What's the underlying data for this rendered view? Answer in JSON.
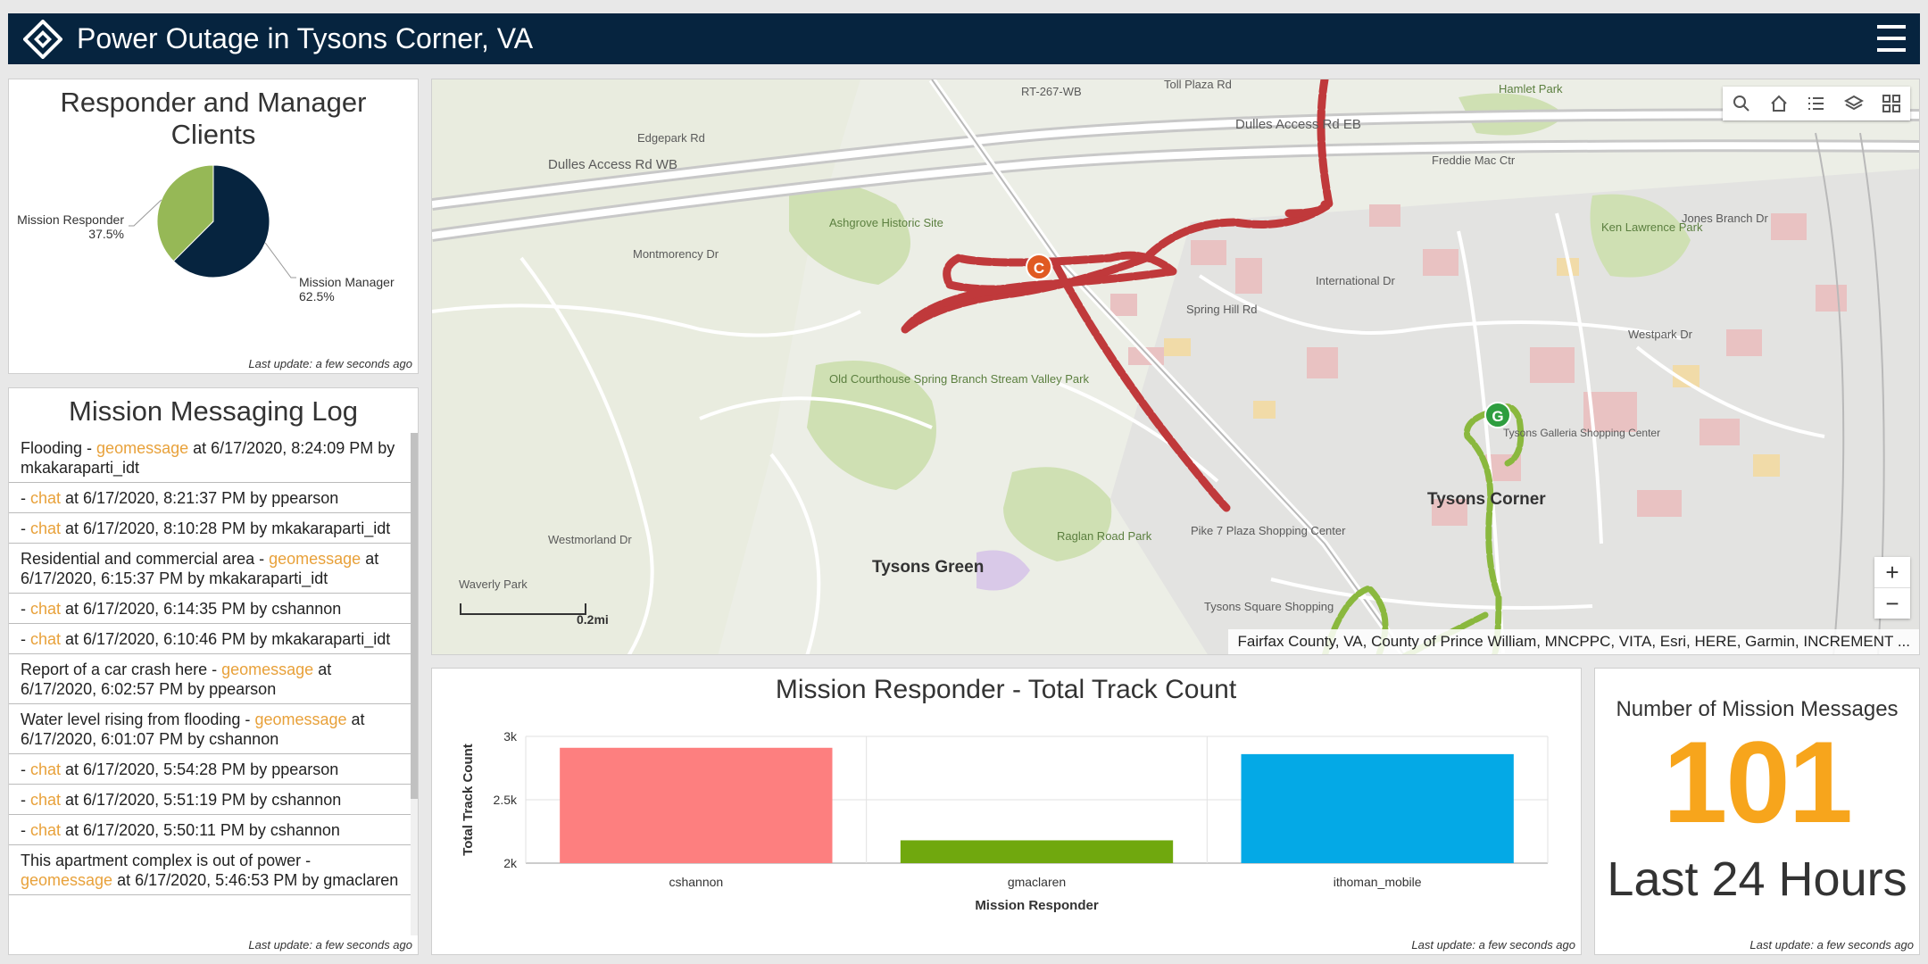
{
  "header": {
    "title": "Power Outage in Tysons Corner, VA"
  },
  "pie_panel": {
    "title": "Responder and Manager Clients",
    "last_update": "Last update: a few seconds ago"
  },
  "log_panel": {
    "title": "Mission Messaging Log",
    "last_update": "Last update: a few seconds ago",
    "items": [
      {
        "pre": "Flooding - ",
        "type": "geomessage",
        "post": " at 6/17/2020, 8:24:09 PM by mkakaraparti_idt"
      },
      {
        "pre": "- ",
        "type": "chat",
        "post": " at 6/17/2020, 8:21:37 PM by ppearson"
      },
      {
        "pre": "- ",
        "type": "chat",
        "post": " at 6/17/2020, 8:10:28 PM by mkakaraparti_idt"
      },
      {
        "pre": "Residential and commercial area - ",
        "type": "geomessage",
        "post": " at 6/17/2020, 6:15:37 PM by mkakaraparti_idt"
      },
      {
        "pre": "- ",
        "type": "chat",
        "post": " at 6/17/2020, 6:14:35 PM by cshannon"
      },
      {
        "pre": "- ",
        "type": "chat",
        "post": " at 6/17/2020, 6:10:46 PM by mkakaraparti_idt"
      },
      {
        "pre": "Report of a car crash here - ",
        "type": "geomessage",
        "post": " at 6/17/2020, 6:02:57 PM by ppearson"
      },
      {
        "pre": "Water level rising from flooding - ",
        "type": "geomessage",
        "post": " at 6/17/2020, 6:01:07 PM by cshannon"
      },
      {
        "pre": "- ",
        "type": "chat",
        "post": " at 6/17/2020, 5:54:28 PM by ppearson"
      },
      {
        "pre": "- ",
        "type": "chat",
        "post": " at 6/17/2020, 5:51:19 PM by cshannon"
      },
      {
        "pre": "- ",
        "type": "chat",
        "post": " at 6/17/2020, 5:50:11 PM by cshannon"
      },
      {
        "pre": "This apartment complex is out of power - ",
        "type": "geomessage",
        "post": " at 6/17/2020, 5:46:53 PM by gmaclaren"
      }
    ]
  },
  "map": {
    "attribution": "Fairfax County, VA, County of Prince William, MNCPPC, VITA, Esri, HERE, Garmin, INCREMENT ...",
    "scale_label": "0.2mi",
    "zoom_in": "+",
    "zoom_out": "−",
    "place_labels": {
      "tysons_green": "Tysons Green",
      "tysons_corner": "Tysons Corner",
      "old_courthouse": "Old Courthouse Spring Branch Stream Valley Park",
      "raglan": "Raglan Road Park",
      "ashgrove": "Ashgrove Historic Site",
      "pike7": "Pike 7 Plaza Shopping Center",
      "ken": "Ken Lawrence Park",
      "hamlet": "Hamlet Park",
      "waverly": "Waverly Park",
      "tysons_sq": "Tysons Square Shopping",
      "galleria": "Tysons Galleria Shopping Center",
      "dulles1": "Dulles Access Rd WB",
      "dulles2": "Dulles Access Rd EB",
      "rt267": "RT-267-WB",
      "toll": "Toll Plaza Rd",
      "freddie": "Freddie Mac Ctr",
      "jones": "Jones Branch Dr",
      "edgepark": "Edgepark Rd",
      "montmorency": "Montmorency Dr",
      "spring_hill": "Spring Hill Rd",
      "international": "International Dr",
      "westpark": "Westpark Dr",
      "westmorland": "Westmorland Dr"
    },
    "markers": {
      "c": "C",
      "g": "G"
    },
    "colors": {
      "route_red": "#c0393b",
      "route_green": "#8ab83e"
    }
  },
  "bar_panel": {
    "last_update": "Last update: a few seconds ago"
  },
  "indicator": {
    "label": "Number of Mission Messages",
    "value": "101",
    "sub": "Last 24 Hours",
    "last_update": "Last update: a few seconds ago",
    "color": "#f7a51c"
  },
  "chart_data": [
    {
      "type": "pie",
      "title": "Responder and Manager Clients",
      "slices": [
        {
          "name": "Mission Manager",
          "value": 62.5,
          "label": "62.5%",
          "color": "#06243f"
        },
        {
          "name": "Mission Responder",
          "value": 37.5,
          "label": "37.5%",
          "color": "#96b856"
        }
      ]
    },
    {
      "type": "bar",
      "title": "Mission Responder - Total Track Count",
      "xlabel": "Mission Responder",
      "ylabel": "Total Track Count",
      "categories": [
        "cshannon",
        "gmaclaren",
        "ithoman_mobile"
      ],
      "values": [
        2910,
        2180,
        2860
      ],
      "colors": [
        "#fd7f7f",
        "#70a80e",
        "#04a9e6"
      ],
      "ylim": [
        2000,
        3000
      ],
      "yticks": [
        "2k",
        "2.5k",
        "3k"
      ],
      "grid": true
    }
  ]
}
